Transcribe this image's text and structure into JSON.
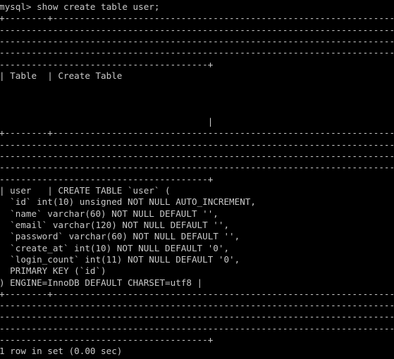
{
  "terminal": {
    "app": "mysql-client",
    "colors": {
      "background": "#000000",
      "foreground": "#c9c9c9"
    },
    "prompt": "mysql>",
    "command": "show create table user;",
    "prompt_line": "mysql> show create table user;",
    "columns": 79,
    "wrapped_separator_segments": [
      "+--------+------------------------------------------------------------------------",
      "--------------------------------------------------------------------------------",
      "--------------------------------------------------------------------------------",
      "--------------------------------------------------------------------------------",
      "---------------------------------------+"
    ],
    "header_row_segments": [
      "| Table  | Create Table",
      "",
      "",
      "",
      "                                       |"
    ],
    "result_table": {
      "headers": [
        "Table",
        "Create Table"
      ],
      "rows": [
        {
          "table": "user",
          "create_table_lines": [
            "CREATE TABLE `user` (",
            "  `id` int(10) unsigned NOT NULL AUTO_INCREMENT,",
            "  `name` varchar(60) NOT NULL DEFAULT '',",
            "  `email` varchar(120) NOT NULL DEFAULT '',",
            "  `password` varchar(60) NOT NULL DEFAULT '',",
            "  `create_at` int(10) NOT NULL DEFAULT '0',",
            "  `login_count` int(11) NOT NULL DEFAULT '0',",
            "  PRIMARY KEY (`id`)",
            ") ENGINE=InnoDB DEFAULT CHARSET=utf8"
          ]
        }
      ]
    },
    "body_lines": [
      "| user   | CREATE TABLE `user` (",
      "  `id` int(10) unsigned NOT NULL AUTO_INCREMENT,",
      "  `name` varchar(60) NOT NULL DEFAULT '',",
      "  `email` varchar(120) NOT NULL DEFAULT '',",
      "  `password` varchar(60) NOT NULL DEFAULT '',",
      "  `create_at` int(10) NOT NULL DEFAULT '0',",
      "  `login_count` int(11) NOT NULL DEFAULT '0',",
      "  PRIMARY KEY (`id`)",
      ") ENGINE=InnoDB DEFAULT CHARSET=utf8 |"
    ],
    "status_line": "1 row in set (0.00 sec)",
    "row_count": 1,
    "query_time": "0.00 sec",
    "screen_lines": [
      "mysql> show create table user;",
      "+--------+------------------------------------------------------------------------",
      "--------------------------------------------------------------------------------",
      "--------------------------------------------------------------------------------",
      "--------------------------------------------------------------------------------",
      "---------------------------------------+",
      "| Table  | Create Table",
      "",
      "",
      "",
      "                                       |",
      "+--------+------------------------------------------------------------------------",
      "--------------------------------------------------------------------------------",
      "--------------------------------------------------------------------------------",
      "--------------------------------------------------------------------------------",
      "---------------------------------------+",
      "| user   | CREATE TABLE `user` (",
      "  `id` int(10) unsigned NOT NULL AUTO_INCREMENT,",
      "  `name` varchar(60) NOT NULL DEFAULT '',",
      "  `email` varchar(120) NOT NULL DEFAULT '',",
      "  `password` varchar(60) NOT NULL DEFAULT '',",
      "  `create_at` int(10) NOT NULL DEFAULT '0',",
      "  `login_count` int(11) NOT NULL DEFAULT '0',",
      "  PRIMARY KEY (`id`)",
      ") ENGINE=InnoDB DEFAULT CHARSET=utf8 |",
      "+--------+------------------------------------------------------------------------",
      "--------------------------------------------------------------------------------",
      "--------------------------------------------------------------------------------",
      "--------------------------------------------------------------------------------",
      "---------------------------------------+",
      "1 row in set (0.00 sec)"
    ]
  }
}
